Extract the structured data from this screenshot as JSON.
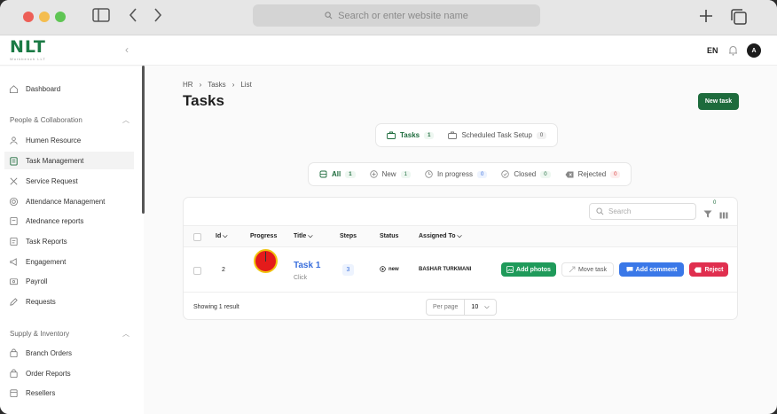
{
  "browser": {
    "url_placeholder": "Search or enter website name"
  },
  "header": {
    "logo_text": "NLT",
    "logo_subtext": "Workbench LLT",
    "language": "EN",
    "avatar_initial": "A"
  },
  "sidebar": {
    "dashboard": "Dashboard",
    "section_people": "People & Collaboration",
    "items_people": [
      {
        "label": "Humen Resource"
      },
      {
        "label": "Task Management"
      },
      {
        "label": "Service Request"
      },
      {
        "label": "Attendance Management"
      },
      {
        "label": "Atednance reports"
      },
      {
        "label": "Task Reports"
      },
      {
        "label": "Engagement"
      },
      {
        "label": "Payroll"
      },
      {
        "label": "Requests"
      }
    ],
    "section_supply": "Supply & Inventory",
    "items_supply": [
      {
        "label": "Branch Orders"
      },
      {
        "label": "Order Reports"
      },
      {
        "label": "Resellers"
      }
    ]
  },
  "breadcrumb": [
    "HR",
    "Tasks",
    "List"
  ],
  "page_title": "Tasks",
  "new_task_label": "New task",
  "view_tabs": [
    {
      "label": "Tasks",
      "count": "1"
    },
    {
      "label": "Scheduled Task Setup",
      "count": "0"
    }
  ],
  "status_filters": [
    {
      "label": "All",
      "count": "1"
    },
    {
      "label": "New",
      "count": "1"
    },
    {
      "label": "In progress",
      "count": "0"
    },
    {
      "label": "Closed",
      "count": "0"
    },
    {
      "label": "Rejected",
      "count": "0"
    }
  ],
  "table": {
    "search_placeholder": "Search",
    "filter_count": "0",
    "columns": [
      "Id",
      "Progress",
      "Title",
      "Steps",
      "Status",
      "Assigned To"
    ],
    "rows": [
      {
        "id": "2",
        "progress": 0,
        "title": "Task 1",
        "subtitle": "Click",
        "steps": "3",
        "status": "new",
        "assigned_to": "BASHAR TURKMANI",
        "actions": [
          "Add photos",
          "Move task",
          "Add comment",
          "Reject"
        ]
      }
    ],
    "footer_text": "Showing 1 result",
    "per_page_label": "Per page",
    "per_page_value": "10"
  },
  "colors": {
    "brand": "#1d6b3c",
    "link": "#3a6fdc",
    "add_photos": "#1f9a5a",
    "add_comment": "#3a78e8",
    "reject": "#e02f4f"
  }
}
